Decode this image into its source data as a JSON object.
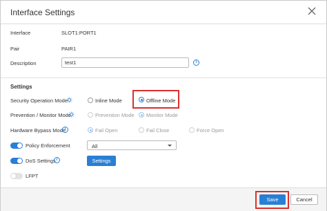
{
  "dialog": {
    "title": "Interface Settings"
  },
  "fields": {
    "interface_label": "Interface",
    "interface_value": "SLOT1:PORT1",
    "pair_label": "Pair",
    "pair_value": "PAIR1",
    "description_label": "Description",
    "description_value": "test1"
  },
  "settings": {
    "section_title": "Settings",
    "security_mode_label": "Security Operation Mode",
    "security_mode_options": [
      "Inline Mode",
      "Offline Mode"
    ],
    "security_mode_selected": "Offline Mode",
    "prevention_label": "Prevention / Monitor Mode",
    "prevention_options": [
      "Prevention Mode",
      "Monitor Mode"
    ],
    "prevention_selected": "Monitor Mode",
    "bypass_label": "Hardware Bypass Mode",
    "bypass_options": [
      "Fail Open",
      "Fail Close",
      "Force Open"
    ],
    "bypass_selected": "Fail Open",
    "policy_label": "Policy Enforcement",
    "policy_enabled": true,
    "policy_select_value": "All",
    "dos_label": "DoS Settings",
    "dos_enabled": true,
    "dos_button": "Settings",
    "lfpt_label": "LFPT",
    "lfpt_enabled": false
  },
  "footer": {
    "save_label": "Save",
    "cancel_label": "Cancel"
  },
  "colors": {
    "accent": "#2a7fd4",
    "highlight": "#d9302b"
  }
}
